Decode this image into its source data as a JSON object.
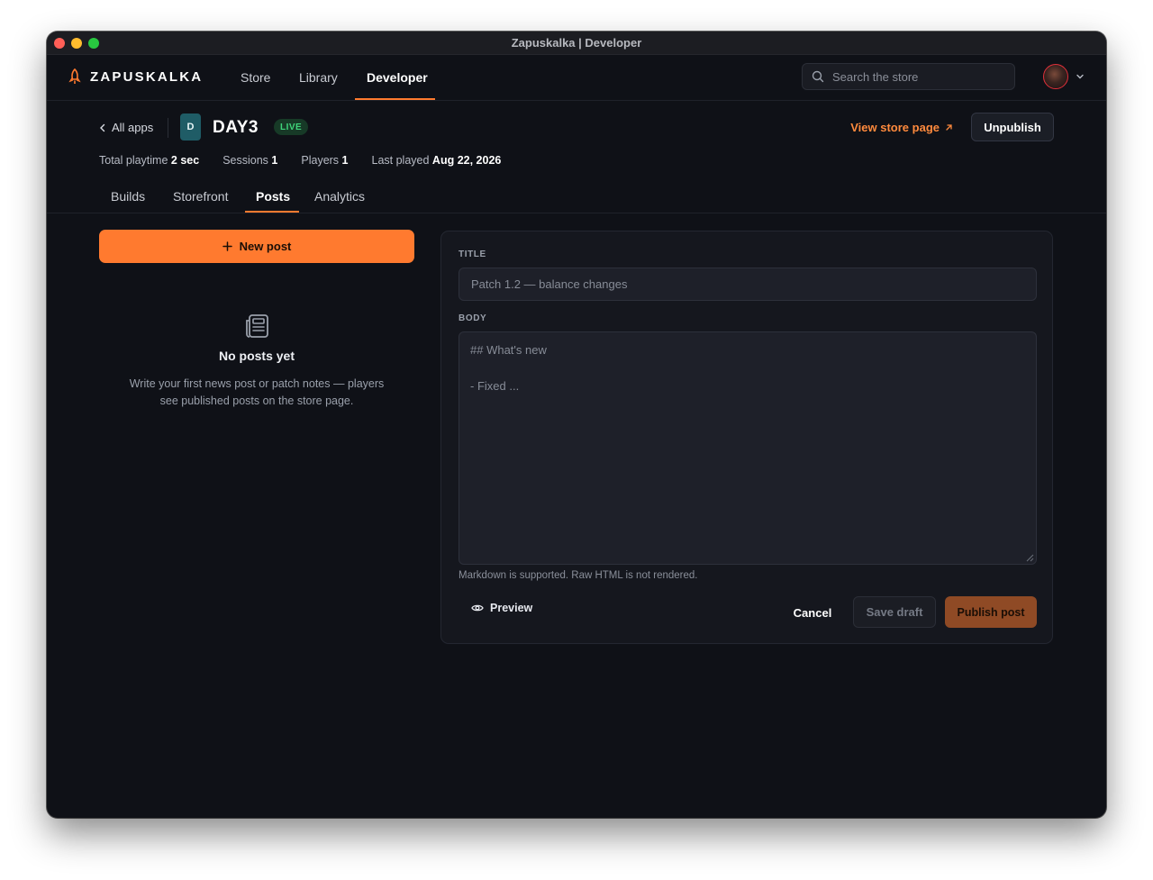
{
  "window": {
    "title": "Zapuskalka | Developer"
  },
  "nav": {
    "brand": "ZAPUSKALKA",
    "links": [
      {
        "label": "Store"
      },
      {
        "label": "Library"
      },
      {
        "label": "Developer",
        "active": true
      }
    ],
    "search_placeholder": "Search the store"
  },
  "app": {
    "back_label": "All apps",
    "icon_letter": "D",
    "name": "DAY3",
    "status": "LIVE",
    "store_link": "View store page",
    "unpublish_label": "Unpublish"
  },
  "stats": [
    {
      "label": "Total playtime",
      "value": "2 sec"
    },
    {
      "label": "Sessions",
      "value": "1"
    },
    {
      "label": "Players",
      "value": "1"
    },
    {
      "label": "Last played",
      "value": "Aug 22, 2026"
    }
  ],
  "tabs": [
    {
      "label": "Builds"
    },
    {
      "label": "Storefront"
    },
    {
      "label": "Posts",
      "active": true
    },
    {
      "label": "Analytics"
    }
  ],
  "posts": {
    "new_post_label": "New post",
    "empty_title": "No posts yet",
    "empty_desc": "Write your first news post or patch notes — players see published posts on the store page."
  },
  "editor": {
    "title_label": "TITLE",
    "title_placeholder": "Patch 1.2 — balance changes",
    "title_value": "",
    "body_label": "BODY",
    "body_placeholder": "## What's new\n\n- Fixed ...",
    "body_value": "",
    "markdown_note": "Markdown is supported. Raw HTML is not rendered.",
    "preview_label": "Preview",
    "cancel_label": "Cancel",
    "save_draft_label": "Save draft",
    "publish_label": "Publish post"
  },
  "colors": {
    "accent": "#ff7a2f",
    "background": "#0f1117",
    "live": "#3fd47a"
  }
}
